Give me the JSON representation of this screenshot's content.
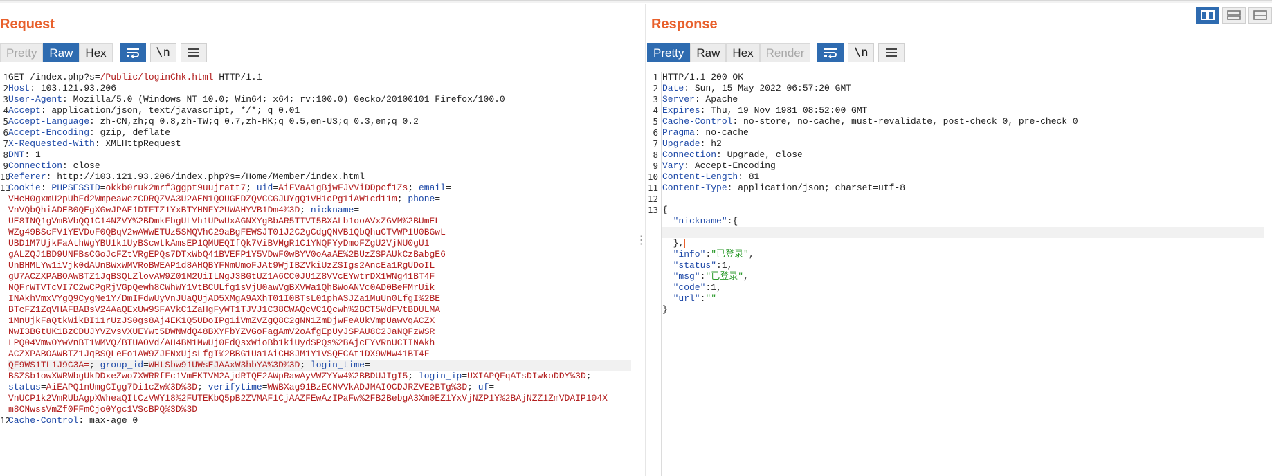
{
  "request": {
    "title": "Request",
    "tabs": [
      "Pretty",
      "Raw",
      "Hex"
    ],
    "selected_tab": "Raw",
    "newline_label": "\\n",
    "line_numbers": [
      "1",
      "2",
      "3",
      "4",
      "5",
      "6",
      "7",
      "8",
      "9",
      "10",
      "11",
      "12"
    ],
    "lines": [
      {
        "p": [
          {
            "t": "GET /index.php?s=",
            "c": "v"
          },
          {
            "t": "/Public/loginChk.html",
            "c": "red"
          },
          {
            "t": " HTTP/1.1",
            "c": "v"
          }
        ]
      },
      {
        "p": [
          {
            "t": "Host",
            "c": "k"
          },
          {
            "t": ": 103.121.93.206",
            "c": "v"
          }
        ]
      },
      {
        "p": [
          {
            "t": "User-Agent",
            "c": "k"
          },
          {
            "t": ": Mozilla/5.0 (Windows NT 10.0; Win64; x64; rv:100.0) Gecko/20100101 Firefox/100.0",
            "c": "v"
          }
        ]
      },
      {
        "p": [
          {
            "t": "Accept",
            "c": "k"
          },
          {
            "t": ": application/json, text/javascript, */*; q=0.01",
            "c": "v"
          }
        ]
      },
      {
        "p": [
          {
            "t": "Accept-Language",
            "c": "k"
          },
          {
            "t": ": zh-CN,zh;q=0.8,zh-TW;q=0.7,zh-HK;q=0.5,en-US;q=0.3,en;q=0.2",
            "c": "v"
          }
        ]
      },
      {
        "p": [
          {
            "t": "Accept-Encoding",
            "c": "k"
          },
          {
            "t": ": gzip, deflate",
            "c": "v"
          }
        ]
      },
      {
        "p": [
          {
            "t": "X-Requested-With",
            "c": "k"
          },
          {
            "t": ": XMLHttpRequest",
            "c": "v"
          }
        ]
      },
      {
        "p": [
          {
            "t": "DNT",
            "c": "k"
          },
          {
            "t": ": 1",
            "c": "v"
          }
        ]
      },
      {
        "p": [
          {
            "t": "Connection",
            "c": "k"
          },
          {
            "t": ": close",
            "c": "v"
          }
        ]
      },
      {
        "p": [
          {
            "t": "Referer",
            "c": "k"
          },
          {
            "t": ": http://103.121.93.206/index.php?s=/Home/Member/index.html",
            "c": "v"
          }
        ]
      },
      {
        "p": [
          {
            "t": "Cookie",
            "c": "k"
          },
          {
            "t": ": ",
            "c": "v"
          },
          {
            "t": "PHPSESSID",
            "c": "k"
          },
          {
            "t": "=",
            "c": "v"
          },
          {
            "t": "okkb0ruk2mrf3ggpt9uujratt7",
            "c": "red"
          },
          {
            "t": "; ",
            "c": "v"
          },
          {
            "t": "uid",
            "c": "k"
          },
          {
            "t": "=",
            "c": "v"
          },
          {
            "t": "AiFVaA1gBjwFJVViDDpcf1Zs",
            "c": "red"
          },
          {
            "t": "; ",
            "c": "v"
          },
          {
            "t": "email",
            "c": "k"
          },
          {
            "t": "=",
            "c": "v"
          }
        ]
      },
      {
        "p": [
          {
            "t": "VHcH0gxmU2pUbFd2WmpeawczCDRQZVA3U2AEN1QOUGEDZQVCCGJUYgQ1VH1cPg1iAW1cd11m",
            "c": "red"
          },
          {
            "t": "; ",
            "c": "v"
          },
          {
            "t": "phone",
            "c": "k"
          },
          {
            "t": "=",
            "c": "v"
          }
        ]
      },
      {
        "p": [
          {
            "t": "VnVQbQhiADEB0QEgXGwJPAE1DTFTZ1YxBTYHNFY2UWAHYVB1Dm4%3D",
            "c": "red"
          },
          {
            "t": "; ",
            "c": "v"
          },
          {
            "t": "nickname",
            "c": "k"
          },
          {
            "t": "=",
            "c": "v"
          }
        ]
      },
      {
        "p": [
          {
            "t": "UE8INQ1gVmBVbQQ1C14NZVY%2BDmkFbgULVh1UPwUxAGNXYgBbAR5TIVI5BXALb1ooAVxZGVM%2BUmEL",
            "c": "red"
          }
        ]
      },
      {
        "p": [
          {
            "t": "WZg49BScFV1YEVDoF0QBqV2wAWwETUz5SMQVhC29aBgFEWSJT01J2C2gCdgQNVB1QbQhuCTVWP1U0BGwL",
            "c": "red"
          }
        ]
      },
      {
        "p": [
          {
            "t": "UBD1M7UjkFaAthWgYBU1k1UyBScwtkAmsEP1QMUEQIfQk7ViBVMgR1C1YNQFYyDmoFZgU2VjNU0gU1",
            "c": "red"
          }
        ]
      },
      {
        "p": [
          {
            "t": "gALZQJ1BD9UNFBsCGoJcFZtVRgEPQs7DTxWbQ41BVEFP1Y5VDwF0wBYV0oAaAE%2BUzZSPAUkCzBabgE6",
            "c": "red"
          }
        ]
      },
      {
        "p": [
          {
            "t": "UnBHMLYw1iVjk0dAUnBWxWMVRoBWEAP1d8AHQBYFNmUmoFJAt9WjIBZVkiUzZSIgs2AncEa1RgUDoIL",
            "c": "red"
          }
        ]
      },
      {
        "p": [
          {
            "t": "gU7ACZXPABOAWBTZ1JqBSQLZlovAW9Z01M2UiILNgJ3BGtUZ1A6CC0JU1Z8VVcEYwtrDX1WNg41BT4F",
            "c": "red"
          }
        ]
      },
      {
        "p": [
          {
            "t": "NQFrWTVTcVI7C2wCPgRjVGpQewh8CWhWY1VtBCULfg1sVjU0awVgBXVWa1QhBWoANVc0AD0BeFMrUik",
            "c": "red"
          }
        ]
      },
      {
        "p": [
          {
            "t": "INAkhVmxVYgQ9CygNe1Y/DmIFdwUyVnJUaQUjAD5XMgA9AXhT01I0BTsL01phASJZa1MuUn0LfgI%2BE",
            "c": "red"
          }
        ]
      },
      {
        "p": [
          {
            "t": "BTcFZ1ZqVHAFBABsV24AaQExUw9SFAVkC1ZaHgFyWT1TJVJ1C38CWAQcVC1Qcwh%2BCT5WdFVtBDULMA",
            "c": "red"
          }
        ]
      },
      {
        "p": [
          {
            "t": "1MnUjkFaQtkWikBI11rUzJS0gs8Aj4EK1Q5UDoIPg1iVmZVZgQ8C2gNN1ZmDjwFeAUkVmpUawVqACZX",
            "c": "red"
          }
        ]
      },
      {
        "p": [
          {
            "t": "NwI3BGtUK1BzCDUJYVZvsVXUEYwt5DWNWdQ48BXYFbYZVGoFagAmV2oAfgEpUyJSPAU8C2JaNQFzWSR",
            "c": "red"
          }
        ]
      },
      {
        "p": [
          {
            "t": "LPQ04VmwOYwVnBT1WMVQ/BTUAOVd/AH4BM1MwUj0FdQsxWioBb1kiUydSPQs%2BAjcEYVRnUCIINAkh",
            "c": "red"
          }
        ]
      },
      {
        "p": [
          {
            "t": "ACZXPABOAWBTZ1JqBSQLeFo1AW9ZJFNxUjsLfgI%2BBG1Ua1AiCH8JM1Y1VSQECAt1DX9WMw41BT4F",
            "c": "red"
          }
        ]
      },
      {
        "p": [
          {
            "t": "QF9WS1TL1J9C3A=",
            "c": "red"
          },
          {
            "t": "; ",
            "c": "v"
          },
          {
            "t": "group_id",
            "c": "k"
          },
          {
            "t": "=",
            "c": "v"
          },
          {
            "t": "WHtSbw91UWsEJAAxW3hbYA%3D%3D",
            "c": "red"
          },
          {
            "t": "; ",
            "c": "v"
          },
          {
            "t": "login_time",
            "c": "k"
          },
          {
            "t": "=",
            "c": "v"
          }
        ],
        "hl": true
      },
      {
        "p": [
          {
            "t": "BSZSb1owXWRWbgUkDDxeZwo7XWRRfFc1VmEKIVM2AjdRIQE2AWpRawAyVWZYYw4%2BBDUJIgI5",
            "c": "red"
          },
          {
            "t": "; ",
            "c": "v"
          },
          {
            "t": "login_ip",
            "c": "k"
          },
          {
            "t": "=",
            "c": "v"
          },
          {
            "t": "UXIAPQFqATsDIwkoDDY%3D",
            "c": "red"
          },
          {
            "t": ";",
            "c": "v"
          }
        ]
      },
      {
        "p": [
          {
            "t": "status",
            "c": "k"
          },
          {
            "t": "=",
            "c": "v"
          },
          {
            "t": "AiEAPQ1nUmgCIgg7Di1cZw%3D%3D",
            "c": "red"
          },
          {
            "t": "; ",
            "c": "v"
          },
          {
            "t": "verifytime",
            "c": "k"
          },
          {
            "t": "=",
            "c": "v"
          },
          {
            "t": "WWBXag91BzECNVVkADJMAIOCDJRZVE2BTg%3D",
            "c": "red"
          },
          {
            "t": "; ",
            "c": "v"
          },
          {
            "t": "uf",
            "c": "k"
          },
          {
            "t": "=",
            "c": "v"
          }
        ]
      },
      {
        "p": [
          {
            "t": "VnUCP1k2VmRUbAgpXWheaQItCzVWY18%2FUTEKbQ5pB2ZVMAF1CjAAZFEwAzIPaFw%2FB2BebgA3Xm0EZ1YxVjNZP1Y%2BAjNZZ1ZmVDAIP104X",
            "c": "red"
          }
        ]
      },
      {
        "p": [
          {
            "t": "m8CNwssVmZf0FFmCjo0Ygc1VScBPQ%3D%3D",
            "c": "red"
          }
        ]
      },
      {
        "p": [
          {
            "t": "Cache-Control",
            "c": "k"
          },
          {
            "t": ": max-age=0",
            "c": "v"
          }
        ]
      }
    ]
  },
  "response": {
    "title": "Response",
    "tabs": [
      "Pretty",
      "Raw",
      "Hex",
      "Render"
    ],
    "selected_tab": "Pretty",
    "disabled_tab": "Render",
    "newline_label": "\\n",
    "line_numbers": [
      "1",
      "2",
      "3",
      "4",
      "5",
      "6",
      "7",
      "8",
      "9",
      "10",
      "11",
      "12",
      "13"
    ],
    "lines": [
      {
        "p": [
          {
            "t": "HTTP/1.1 200 OK",
            "c": "v"
          }
        ]
      },
      {
        "p": [
          {
            "t": "Date",
            "c": "k"
          },
          {
            "t": ": Sun, 15 May 2022 06:57:20 GMT",
            "c": "v"
          }
        ]
      },
      {
        "p": [
          {
            "t": "Server",
            "c": "k"
          },
          {
            "t": ": Apache",
            "c": "v"
          }
        ]
      },
      {
        "p": [
          {
            "t": "Expires",
            "c": "k"
          },
          {
            "t": ": Thu, 19 Nov 1981 08:52:00 GMT",
            "c": "v"
          }
        ]
      },
      {
        "p": [
          {
            "t": "Cache-Control",
            "c": "k"
          },
          {
            "t": ": no-store, no-cache, must-revalidate, post-check=0, pre-check=0",
            "c": "v"
          }
        ]
      },
      {
        "p": [
          {
            "t": "Pragma",
            "c": "k"
          },
          {
            "t": ": no-cache",
            "c": "v"
          }
        ]
      },
      {
        "p": [
          {
            "t": "Upgrade",
            "c": "k"
          },
          {
            "t": ": h2",
            "c": "v"
          }
        ]
      },
      {
        "p": [
          {
            "t": "Connection",
            "c": "k"
          },
          {
            "t": ": Upgrade, close",
            "c": "v"
          }
        ]
      },
      {
        "p": [
          {
            "t": "Vary",
            "c": "k"
          },
          {
            "t": ": Accept-Encoding",
            "c": "v"
          }
        ]
      },
      {
        "p": [
          {
            "t": "Content-Length",
            "c": "k"
          },
          {
            "t": ": 81",
            "c": "v"
          }
        ]
      },
      {
        "p": [
          {
            "t": "Content-Type",
            "c": "k"
          },
          {
            "t": ": application/json; charset=utf-8",
            "c": "v"
          }
        ]
      },
      {
        "p": [
          {
            "t": "",
            "c": "v"
          }
        ]
      },
      {
        "p": [
          {
            "t": "{",
            "c": "v"
          }
        ]
      },
      {
        "p": [
          {
            "t": "  \"nickname\"",
            "c": "jk"
          },
          {
            "t": ":{",
            "c": "v"
          }
        ]
      },
      {
        "p": [
          {
            "t": "  ",
            "c": "v"
          }
        ],
        "hl": true
      },
      {
        "p": [
          {
            "t": "  },",
            "c": "v"
          }
        ],
        "caret": true
      },
      {
        "p": [
          {
            "t": "  \"info\"",
            "c": "jk"
          },
          {
            "t": ":",
            "c": "v"
          },
          {
            "t": "\"已登录\"",
            "c": "str"
          },
          {
            "t": ",",
            "c": "v"
          }
        ]
      },
      {
        "p": [
          {
            "t": "  \"status\"",
            "c": "jk"
          },
          {
            "t": ":1,",
            "c": "v"
          }
        ]
      },
      {
        "p": [
          {
            "t": "  \"msg\"",
            "c": "jk"
          },
          {
            "t": ":",
            "c": "v"
          },
          {
            "t": "\"已登录\"",
            "c": "str"
          },
          {
            "t": ",",
            "c": "v"
          }
        ]
      },
      {
        "p": [
          {
            "t": "  \"code\"",
            "c": "jk"
          },
          {
            "t": ":1,",
            "c": "v"
          }
        ]
      },
      {
        "p": [
          {
            "t": "  \"url\"",
            "c": "jk"
          },
          {
            "t": ":",
            "c": "v"
          },
          {
            "t": "\"\"",
            "c": "str"
          }
        ]
      },
      {
        "p": [
          {
            "t": "}",
            "c": "v"
          }
        ]
      }
    ],
    "line_number_rows": [
      0,
      1,
      2,
      3,
      4,
      5,
      6,
      7,
      8,
      9,
      10,
      11,
      12
    ]
  },
  "request_line_number_rows": [
    0,
    1,
    2,
    3,
    4,
    5,
    6,
    7,
    8,
    9,
    10,
    31
  ],
  "colors": {
    "accent": "#2e6bb0",
    "title": "#e8602c",
    "key": "#1f4aa8",
    "value_red": "#b21e1e",
    "json_string": "#2b9a2b"
  },
  "icons": {
    "wrap": "wrap-lines-icon",
    "menu": "hamburger-menu-icon",
    "layout_split": "split-view-icon",
    "layout_horizontal": "horizontal-view-icon",
    "layout_vertical": "vertical-view-icon"
  }
}
